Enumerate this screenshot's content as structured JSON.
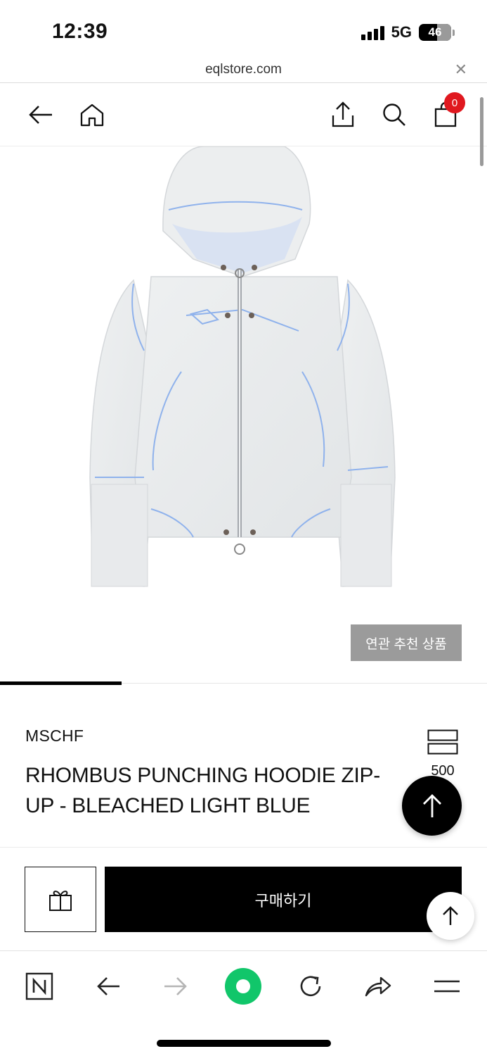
{
  "status_bar": {
    "time": "12:39",
    "network": "5G",
    "battery": "46"
  },
  "url_bar": {
    "url": "eqlstore.com",
    "close_icon": "close-icon"
  },
  "header": {
    "icons": [
      "back-arrow-icon",
      "home-icon",
      "share-icon",
      "search-icon",
      "shopping-bag-icon"
    ],
    "cart_count": "0",
    "accent_color": "#e0181f"
  },
  "product": {
    "image_icon": "hoodie-product-image",
    "image_colors": {
      "fabric": "#e9ebec",
      "stitching": "#8fb2ec"
    },
    "related_button": "연관 추천 상품",
    "brand": "MSCHF",
    "name": "RHOMBUS PUNCHING HOODIE ZIP-UP - BLEACHED LIGHT BLUE",
    "like_count": "500"
  },
  "actions": {
    "buy_label": "구매하기",
    "gift_icon": "gift-icon",
    "scroll_top_icon": "arrow-up-icon"
  },
  "browser_toolbar": {
    "icons": [
      "naver-n-icon",
      "back-icon",
      "forward-icon",
      "green-dot-icon",
      "reload-icon",
      "share-icon",
      "menu-icon"
    ],
    "accent_color": "#11c66a"
  }
}
